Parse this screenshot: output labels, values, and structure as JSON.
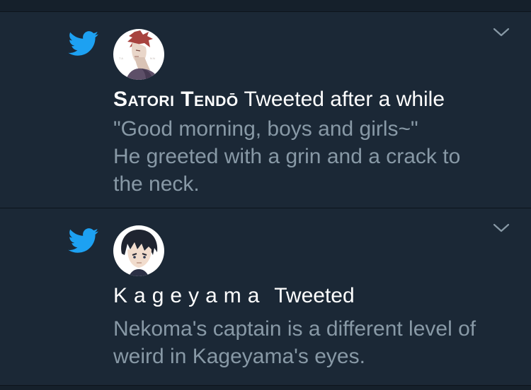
{
  "notifications": [
    {
      "icon": "twitter-bird-icon",
      "name": "Satori Tendō",
      "action": "Tweeted after a while",
      "lines": [
        "\"Good morning, boys and girls~\"",
        "He greeted with a grin and a crack to",
        "the neck."
      ]
    },
    {
      "icon": "twitter-bird-icon",
      "name": "Kageyama",
      "action": "Tweeted",
      "lines": [
        "Nekoma's captain is a different level of",
        "weird in Kageyama's eyes."
      ]
    }
  ],
  "colors": {
    "background": "#15202b",
    "card": "#1b2836",
    "twitter_blue": "#1da1f2",
    "secondary_text": "#8899a6",
    "primary_text": "#ffffff"
  }
}
